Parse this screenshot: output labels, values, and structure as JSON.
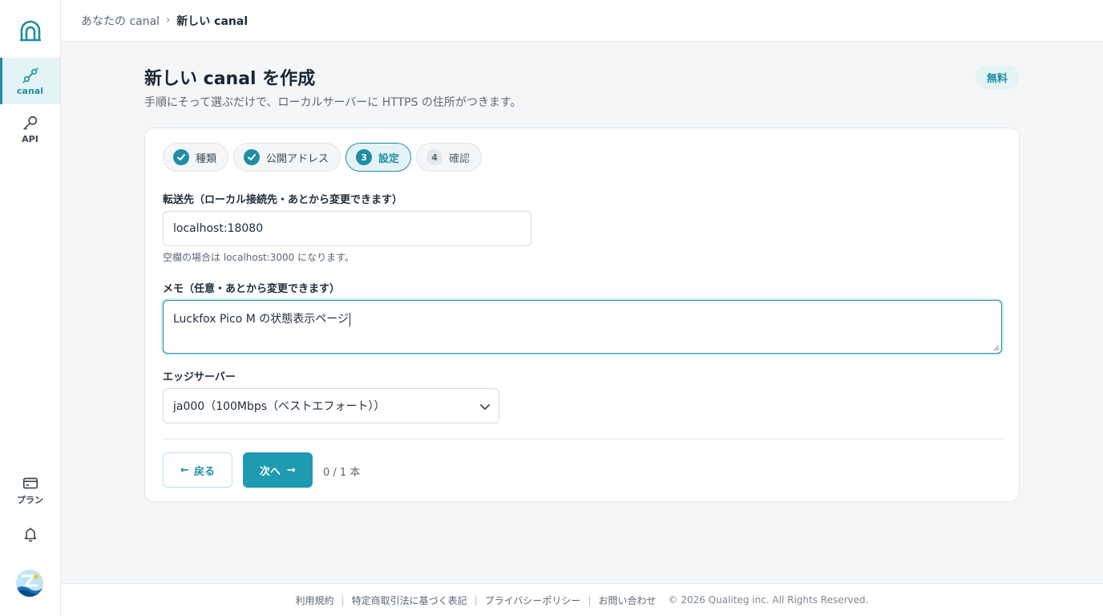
{
  "breadcrumb": {
    "parent": "あなたの canal",
    "current": "新しい canal"
  },
  "sidebar": {
    "items": [
      {
        "label": "canal",
        "icon": "link-icon"
      },
      {
        "label": "API",
        "icon": "key-icon"
      },
      {
        "label": "プラン",
        "icon": "card-icon"
      }
    ]
  },
  "page": {
    "title": "新しい canal を作成",
    "subtitle": "手順にそって選ぶだけで、ローカルサーバーに HTTPS の住所がつきます。",
    "badge": "無料"
  },
  "steps": [
    {
      "num": "",
      "label": "種類",
      "state": "done"
    },
    {
      "num": "",
      "label": "公開アドレス",
      "state": "done"
    },
    {
      "num": "3",
      "label": "設定",
      "state": "active"
    },
    {
      "num": "4",
      "label": "確認",
      "state": "pending"
    }
  ],
  "form": {
    "forward_label": "転送先（ローカル接続先・あとから変更できます）",
    "forward_value": "localhost:18080",
    "forward_help": "空欄の場合は localhost:3000 になります。",
    "memo_label": "メモ（任意・あとから変更できます）",
    "memo_value": "Luckfox Pico M の状態表示ページ",
    "edge_label": "エッジサーバー",
    "edge_value": "ja000（100Mbps（ベストエフォート））"
  },
  "actions": {
    "back": "戻る",
    "next": "次へ",
    "count": "0 / 1 本"
  },
  "footer": {
    "links": [
      "利用規約",
      "特定商取引法に基づく表記",
      "プライバシーポリシー",
      "お問い合わせ"
    ],
    "copyright": "© 2026 Qualiteg inc. All Rights Reserved."
  },
  "colors": {
    "accent": "#1e9bb0",
    "accent_light": "#e3f3f6"
  }
}
